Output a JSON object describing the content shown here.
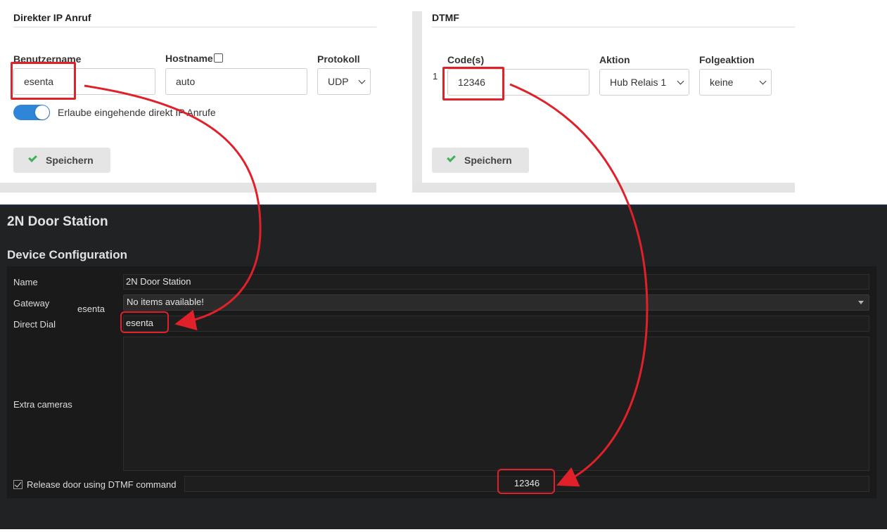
{
  "direct_ip": {
    "title": "Direkter IP Anruf",
    "username_label": "Benutzername",
    "username_value": "esenta",
    "hostname_label": "Hostname",
    "hostname_value": "auto",
    "protocol_label": "Protokoll",
    "protocol_value": "UDP",
    "toggle_label": "Erlaube eingehende direkt IP Anrufe",
    "save_label": "Speichern"
  },
  "dtmf": {
    "title": "DTMF",
    "code_label": "Code(s)",
    "row_index": "1",
    "code_value": "12346",
    "action_label": "Aktion",
    "action_value": "Hub Relais 1",
    "follow_label": "Folgeaktion",
    "follow_value": "keine",
    "save_label": "Speichern"
  },
  "device": {
    "window_title": "2N Door Station",
    "section_title": "Device Configuration",
    "name_label": "Name",
    "name_value": "2N Door Station",
    "gateway_label": "Gateway",
    "gateway_hint": "esenta",
    "gateway_value": "No items available!",
    "direct_dial_label": "Direct Dial",
    "direct_dial_value": "esenta",
    "extra_cameras_label": "Extra cameras",
    "release_door_label": "Release door using DTMF command",
    "release_door_checked": true,
    "dtmf_command_value": "12346"
  },
  "colors": {
    "annotation_red": "#e0212a",
    "toggle_blue": "#2f86d8",
    "check_green": "#3cb15a"
  }
}
